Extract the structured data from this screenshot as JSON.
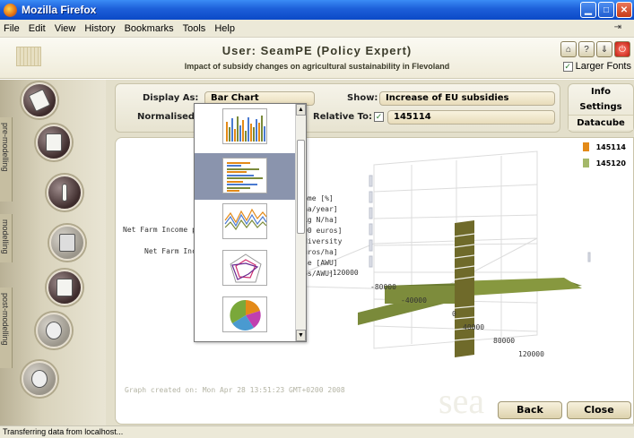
{
  "window": {
    "title": "Mozilla Firefox"
  },
  "menu": [
    "File",
    "Edit",
    "View",
    "History",
    "Bookmarks",
    "Tools",
    "Help"
  ],
  "header": {
    "user_title": "User: SeamPE (Policy Expert)",
    "subtitle": "Impact of subsidy changes on agricultural sustainability in Flevoland",
    "larger_fonts": "Larger Fonts"
  },
  "sidebar": {
    "tabs": [
      "pre-modelling",
      "modelling",
      "post-modelling"
    ]
  },
  "controls": {
    "display_as_label": "Display As:",
    "display_as_value": "Bar Chart",
    "normalised_label": "Normalised:",
    "show_label": "Show:",
    "show_value": "Increase of EU subsidies",
    "relative_to_label": "Relative To:",
    "relative_to_value": "145114"
  },
  "info_panel": [
    "Info",
    "Settings",
    "Datacube"
  ],
  "chart": {
    "labels": [
      "m Income [%]",
      "O3-N/ha/year]",
      "Use [kg N/ha]",
      "s [1000 euros]",
      "Crop diversity",
      "001 euros/ha]",
      "our use [AWU]",
      "0 euros/AWU]"
    ],
    "left_labels": [
      "Net Farm Income p",
      "Net Farm Inc"
    ],
    "axis_ticks": [
      "-120000",
      "-80000",
      "-40000",
      "0",
      "40000",
      "80000",
      "120000"
    ],
    "legend": [
      {
        "name": "145114",
        "color": "#e38a18"
      },
      {
        "name": "145120",
        "color": "#a4b86a"
      }
    ],
    "graph_note": "Graph created on: Mon Apr 28 13:51:23 GMT+0200 2008"
  },
  "buttons": {
    "back": "Back",
    "close": "Close"
  },
  "status": "Transferring data from localhost..."
}
